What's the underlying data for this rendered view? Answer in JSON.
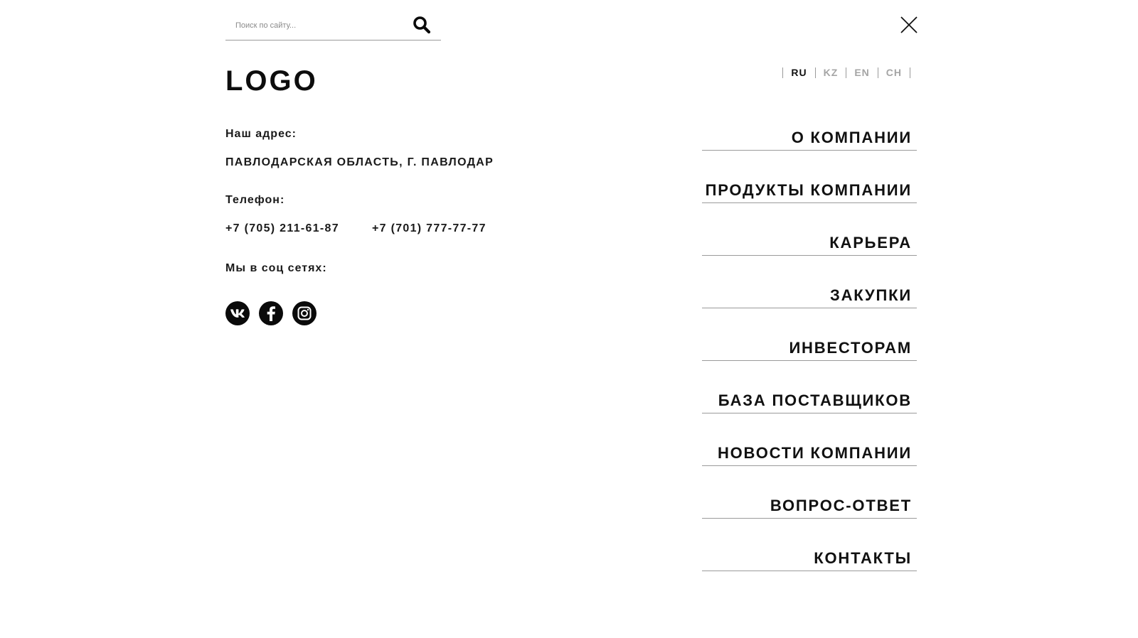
{
  "search": {
    "placeholder": "Поиск по сайту..."
  },
  "logo": {
    "text": "LOGO"
  },
  "languages": [
    {
      "code": "RU",
      "active": true
    },
    {
      "code": "KZ",
      "active": false
    },
    {
      "code": "EN",
      "active": false
    },
    {
      "code": "CH",
      "active": false
    }
  ],
  "contacts": {
    "address_label": "Наш адрес:",
    "address_value": "ПАВЛОДАРСКАЯ ОБЛАСТЬ, Г. ПАВЛОДАР",
    "phone_label": "Телефон:",
    "phone_1": "+7 (705) 211-61-87",
    "phone_2": "+7 (701) 777-77-77",
    "social_label": "Мы в соц сетях:"
  },
  "socials": [
    {
      "name": "vk",
      "icon": "vk-icon"
    },
    {
      "name": "facebook",
      "icon": "facebook-icon"
    },
    {
      "name": "instagram",
      "icon": "instagram-icon"
    }
  ],
  "menu": {
    "items": [
      {
        "label": "О КОМПАНИИ"
      },
      {
        "label": "ПРОДУКТЫ КОМПАНИИ"
      },
      {
        "label": "КАРЬЕРА"
      },
      {
        "label": "ЗАКУПКИ"
      },
      {
        "label": "ИНВЕСТОРАМ"
      },
      {
        "label": "БАЗА ПОСТАВЩИКОВ"
      },
      {
        "label": "НОВОСТИ КОМПАНИИ"
      },
      {
        "label": "ВОПРОС-ОТВЕТ"
      },
      {
        "label": "КОНТАКТЫ"
      }
    ]
  },
  "colors": {
    "text": "#111111",
    "muted": "#a5a5a5",
    "divider": "#9a9a9a",
    "background": "#ffffff"
  }
}
